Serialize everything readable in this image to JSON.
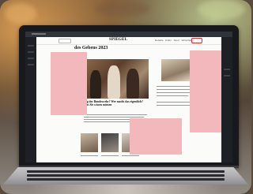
{
  "scene": {
    "description_colors": {
      "background_warm": "#d59a52",
      "background_green": "#b5c08a",
      "laptop_bezel": "#17191c",
      "redaction": "#f2b8bb"
    }
  },
  "laptop": {
    "website": {
      "brand": "SPIEGEL",
      "nav_text": "Debatte · Kultur · Sport · Wirtschaft",
      "headline": "des Gebens 2023",
      "lead_story_title": "Tag der Bundeswehr? Wer macht das eigentlich? Was Sie wissen müssen"
    }
  }
}
